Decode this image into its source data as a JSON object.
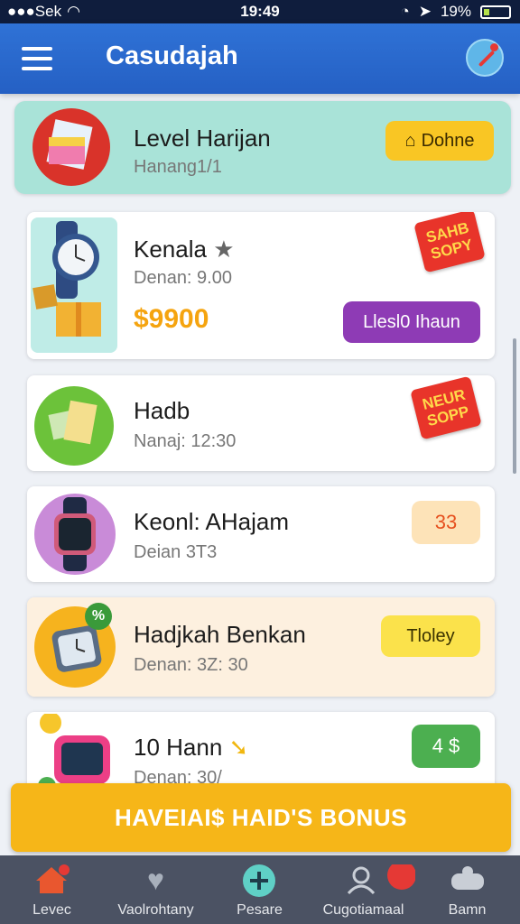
{
  "status": {
    "carrier": "●●●Sek",
    "time": "19:49",
    "battery": "19%"
  },
  "header": {
    "title": "Casudajah"
  },
  "featured": {
    "title": "Level Harijan",
    "subtitle": "Hanang1/1",
    "button": "Dohne"
  },
  "items": [
    {
      "title": "Kenala",
      "subtitle": "Denan: 9.00",
      "price": "$9900",
      "button": "Llesl0 Ihaun",
      "stamp": "SAHB SOPY"
    },
    {
      "title": "Hadb",
      "subtitle": "Nanaj: 12:30",
      "stamp": "NEUR SOPP"
    },
    {
      "title": "Keonl: AHajam",
      "subtitle": "Deian 3T3",
      "badge": "33"
    },
    {
      "title": "Hadjkah Benkan",
      "subtitle": "Denan: 3Z: 30",
      "button": "Tloley"
    },
    {
      "title": "10 Hann",
      "subtitle": "Denan: 30/",
      "badge": "4 $"
    }
  ],
  "bonus": {
    "label": "HAVEIAI$ HAID'S BONUS"
  },
  "nav": [
    {
      "label": "Levec",
      "icon": "home-icon"
    },
    {
      "label": "Vaolrohtany",
      "icon": "heart-icon"
    },
    {
      "label": "Pesare",
      "icon": "plus-icon"
    },
    {
      "label": "Cugotiamaal",
      "icon": "user-icon"
    },
    {
      "label": "Bamn",
      "icon": "gamepad-icon"
    }
  ],
  "colors": {
    "primary": "#2f72d6",
    "accent": "#f6b618",
    "purple": "#8e3bb5",
    "green": "#4caf50"
  }
}
